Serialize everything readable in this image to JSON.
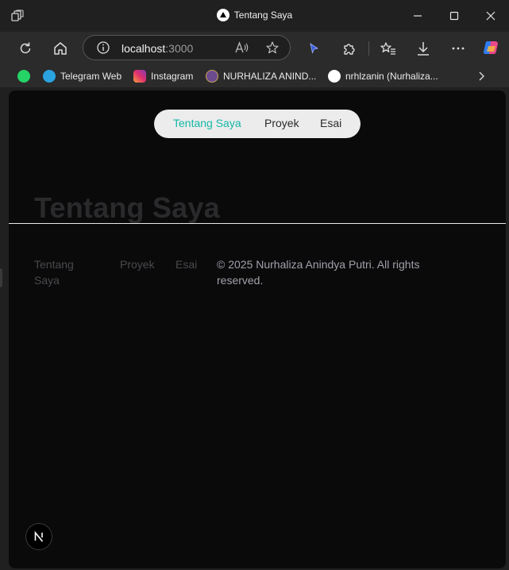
{
  "window": {
    "title": "Tentang Saya"
  },
  "address_bar": {
    "host": "localhost",
    "port": ":3000"
  },
  "bookmarks": [
    {
      "label": "",
      "icon": "whatsapp-icon",
      "color": "#25d366"
    },
    {
      "label": "Telegram Web",
      "icon": "telegram-icon",
      "color": "#2aa3e0"
    },
    {
      "label": "Instagram",
      "icon": "instagram-icon",
      "color": "#e1306c"
    },
    {
      "label": "NURHALIZA ANIND...",
      "icon": "university-seal-icon",
      "color": "#6b4a8e"
    },
    {
      "label": "nrhlzanin (Nurhaliza...",
      "icon": "github-icon",
      "color": "#ffffff"
    }
  ],
  "page": {
    "nav": {
      "items": [
        "Tentang Saya",
        "Proyek",
        "Esai"
      ],
      "active_index": 0,
      "accent_color": "#14b8a6"
    },
    "hero_title": "Tentang Saya",
    "footer": {
      "links": [
        "Tentang Saya",
        "Proyek",
        "Esai"
      ],
      "copyright": "© 2025 Nurhaliza Anindya Putri. All rights reserved."
    },
    "next_badge": "N"
  }
}
